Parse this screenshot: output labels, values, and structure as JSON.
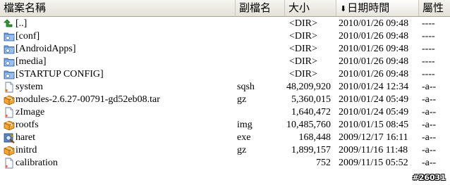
{
  "columns": {
    "name": "檔案名稱",
    "ext": "副檔名",
    "size": "大小",
    "date": "日期時間",
    "attr": "屬性"
  },
  "sort": {
    "column": "date",
    "direction": "descending"
  },
  "rows": [
    {
      "icon": "up-arrow-icon",
      "name": "[..]",
      "ext": "",
      "size": "<DIR>",
      "date": "2010/01/26 09:48",
      "attr": "----"
    },
    {
      "icon": "folder-icon",
      "name": "[conf]",
      "ext": "",
      "size": "<DIR>",
      "date": "2010/01/26 09:48",
      "attr": "----"
    },
    {
      "icon": "folder-icon",
      "name": "[AndroidApps]",
      "ext": "",
      "size": "<DIR>",
      "date": "2010/01/26 09:48",
      "attr": "----"
    },
    {
      "icon": "folder-icon",
      "name": "[media]",
      "ext": "",
      "size": "<DIR>",
      "date": "2010/01/26 09:48",
      "attr": "----"
    },
    {
      "icon": "folder-icon",
      "name": "[STARTUP CONFIG]",
      "ext": "",
      "size": "<DIR>",
      "date": "2010/01/26 09:48",
      "attr": "----"
    },
    {
      "icon": "file-icon",
      "name": "system",
      "ext": "sqsh",
      "size": "48,209,920",
      "date": "2010/01/24 12:34",
      "attr": "-a--"
    },
    {
      "icon": "package-icon",
      "name": "modules-2.6.27-00791-gd52eb08.tar",
      "ext": "gz",
      "size": "5,360,015",
      "date": "2010/01/24 05:49",
      "attr": "-a--"
    },
    {
      "icon": "file-icon",
      "name": "zImage",
      "ext": "",
      "size": "1,640,472",
      "date": "2010/01/24 05:49",
      "attr": "-a--"
    },
    {
      "icon": "package-icon",
      "name": "rootfs",
      "ext": "img",
      "size": "10,485,760",
      "date": "2010/01/15 08:45",
      "attr": "-a--"
    },
    {
      "icon": "executable-icon",
      "name": "haret",
      "ext": "exe",
      "size": "168,448",
      "date": "2009/12/17 16:11",
      "attr": "-a--"
    },
    {
      "icon": "package-icon",
      "name": "initrd",
      "ext": "gz",
      "size": "1,899,157",
      "date": "2009/11/16 11:48",
      "attr": "-a--"
    },
    {
      "icon": "file-icon",
      "name": "calibration",
      "ext": "",
      "size": "752",
      "date": "2009/11/15 05:52",
      "attr": "-a--"
    }
  ],
  "watermark": "#26031"
}
